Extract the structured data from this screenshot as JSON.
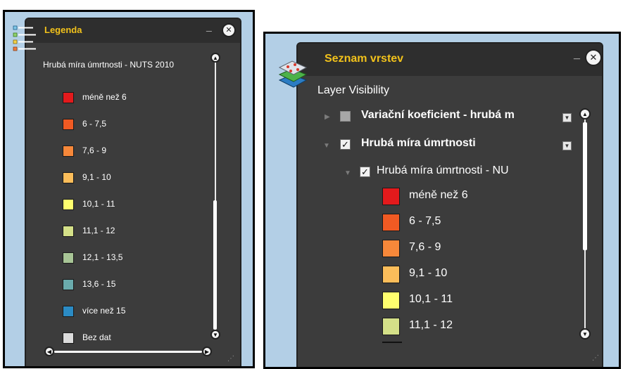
{
  "legend_panel": {
    "title": "Legenda",
    "minimize": "_",
    "close": "✕",
    "layer_title": "Hrubá míra úmrtnosti - NUTS 2010",
    "items": [
      {
        "label": "méně než 6",
        "color": "#e31a1c"
      },
      {
        "label": "6 - 7,5",
        "color": "#f05a23"
      },
      {
        "label": "7,6 - 9",
        "color": "#f7883a"
      },
      {
        "label": "9,1 - 10",
        "color": "#fbbd5a"
      },
      {
        "label": "10,1 - 11",
        "color": "#ffff6e"
      },
      {
        "label": "11,1 - 12",
        "color": "#d4e088"
      },
      {
        "label": "12,1 - 13,5",
        "color": "#a8c596"
      },
      {
        "label": "13,6 - 15",
        "color": "#6aabac"
      },
      {
        "label": "více než 15",
        "color": "#2b8bc4"
      },
      {
        "label": "Bez dat",
        "color": "#dcdcdc"
      }
    ]
  },
  "layer_panel": {
    "title": "Seznam vrstev",
    "minimize": "_",
    "close": "✕",
    "heading": "Layer Visibility",
    "layers": [
      {
        "label": "Variační koeficient - hrubá m",
        "checked": false,
        "expanded": false
      },
      {
        "label": "Hrubá míra úmrtnosti",
        "checked": true,
        "expanded": true
      }
    ],
    "sublayer": {
      "label": "Hrubá míra úmrtnosti - NU",
      "checked": true
    },
    "items": [
      {
        "label": "méně než 6",
        "color": "#e31a1c"
      },
      {
        "label": "6 - 7,5",
        "color": "#f05a23"
      },
      {
        "label": "7,6 - 9",
        "color": "#f7883a"
      },
      {
        "label": "9,1 - 10",
        "color": "#fbbd5a"
      },
      {
        "label": "10,1 - 11",
        "color": "#ffff6e"
      },
      {
        "label": "11,1 - 12",
        "color": "#d4e088"
      }
    ]
  },
  "icons": {
    "legend": "legend-list-icon",
    "layers": "layers-stack-icon",
    "expand": "triangle-right-icon",
    "collapse": "triangle-down-icon",
    "menu": "dropdown-arrow-icon"
  },
  "colors": {
    "title": "#f2c21b",
    "panel_bg": "#3c3c3c",
    "header_bg": "#2e2e2e",
    "map_bg": "#b3cfe6"
  }
}
